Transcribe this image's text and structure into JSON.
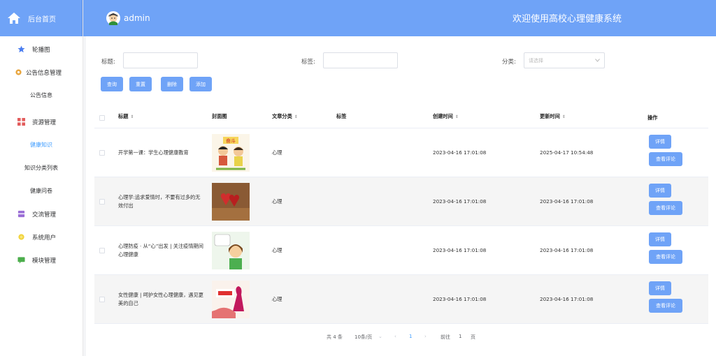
{
  "sidebar": {
    "home_label": "后台首页",
    "items": [
      {
        "label": "轮播图",
        "icon": "star-icon"
      },
      {
        "label": "公告信息管理",
        "icon": "gear-icon"
      },
      {
        "label": "公告信息",
        "sub": true
      },
      {
        "label": "资源管理",
        "icon": "grid-icon"
      },
      {
        "label": "健康知识",
        "sub": true,
        "active": true
      },
      {
        "label": "知识分类列表",
        "sub": true
      },
      {
        "label": "健康问卷",
        "sub": true
      },
      {
        "label": "交流管理",
        "icon": "box-icon"
      },
      {
        "label": "系统用户",
        "icon": "sun-icon"
      },
      {
        "label": "模块管理",
        "icon": "chat-icon"
      }
    ]
  },
  "header": {
    "username": "admin",
    "welcome": "欢迎使用高校心理健康系统"
  },
  "filters": {
    "title_label": "标题:",
    "tag_label": "标签:",
    "category_label": "分类:",
    "category_placeholder": "请选择"
  },
  "buttons": {
    "search": "查询",
    "reset": "重置",
    "delete": "删除",
    "add": "添加"
  },
  "table": {
    "headers": {
      "title": "标题",
      "cover": "封面图",
      "category": "文章分类",
      "tag": "标签",
      "created": "创建时间",
      "updated": "更新时间",
      "actions": "操作"
    },
    "detail_label": "详情",
    "comments_label": "查看评论",
    "rows": [
      {
        "title": "开学第一课：学生心理健康教育",
        "category": "心理",
        "created": "2023-04-16 17:01:08",
        "updated": "2025-04-17 10:54:48"
      },
      {
        "title": "心理学:追求爱情时，不要有过多的无效付出",
        "category": "心理",
        "created": "2023-04-16 17:01:08",
        "updated": "2023-04-16 17:01:08"
      },
      {
        "title": "心理防疫 · 从“心”出发 | 关注疫情期间心理健康",
        "category": "心理",
        "created": "2023-04-16 17:01:08",
        "updated": "2023-04-16 17:01:08"
      },
      {
        "title": "女性健康 | 呵护女性心理健康，遇见更美的自己",
        "category": "心理",
        "created": "2023-04-16 17:01:08",
        "updated": "2023-04-16 17:01:08"
      }
    ]
  },
  "pagination": {
    "total": "共 4 条",
    "page_size": "10条/页",
    "current": "1",
    "goto_label": "前往",
    "goto_value": "1",
    "page_suffix": "页"
  },
  "colors": {
    "primary": "#6fa3f7",
    "active_text": "#409eff"
  }
}
